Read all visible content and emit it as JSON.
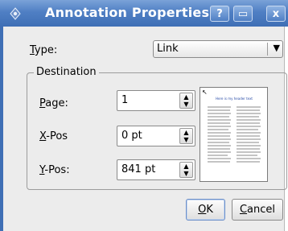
{
  "window": {
    "title": "Annotation Properties",
    "help_button": "?",
    "maximize_button": "▭",
    "close_button": "x"
  },
  "type_field": {
    "label": "Type:",
    "accel": "T",
    "label_rest": "ype:",
    "value": "Link",
    "arrow": "▼"
  },
  "destination": {
    "title": "Destination",
    "page": {
      "accel": "P",
      "label_rest": "age:",
      "value": "1"
    },
    "xpos": {
      "accel": "X",
      "label_rest": "-Pos",
      "value": "0 pt"
    },
    "ypos": {
      "accel": "Y",
      "label_rest": "-Pos:",
      "value": "841 pt"
    }
  },
  "spin_arrows": {
    "up": "▲",
    "down": "▼"
  },
  "preview": {
    "header_text": "Here is my header text"
  },
  "buttons": {
    "ok": {
      "accel": "O",
      "label_rest": "K"
    },
    "cancel": {
      "accel": "C",
      "label_rest": "ancel"
    }
  },
  "colors": {
    "titlebar": "#4f7fc4",
    "dialog_bg": "#ececec",
    "accent": "#2b4ea8"
  }
}
